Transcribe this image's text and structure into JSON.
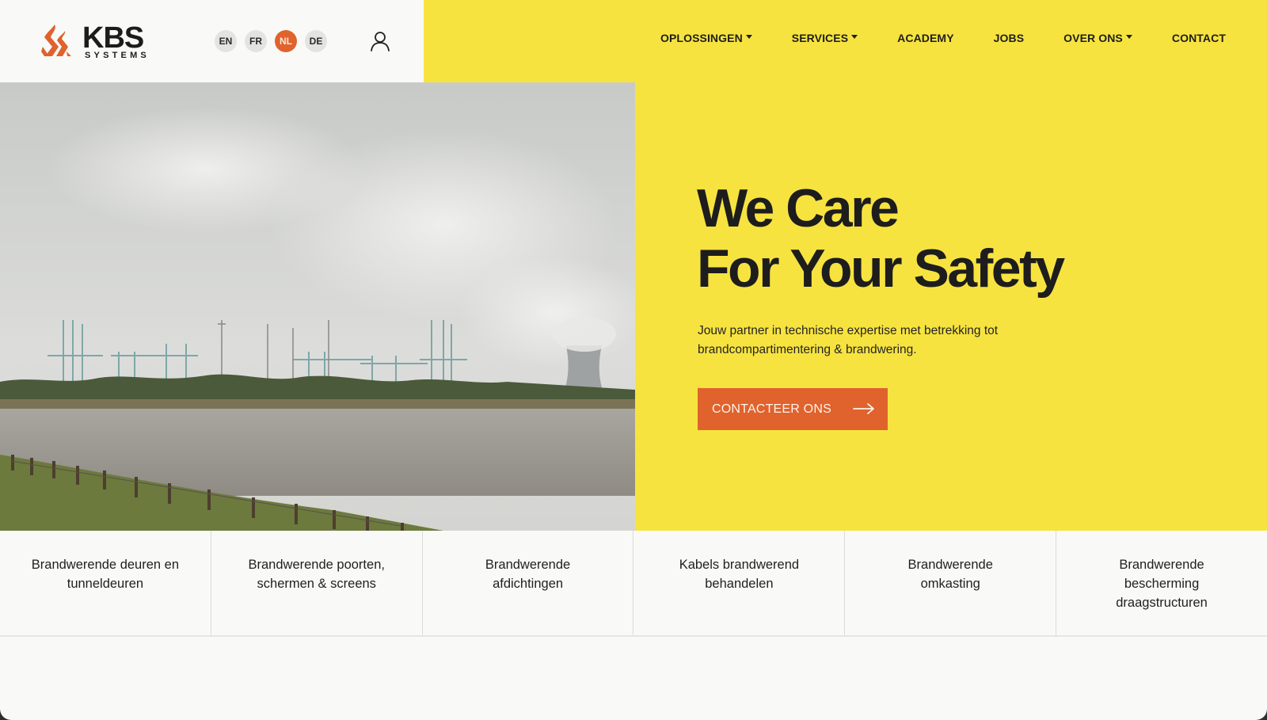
{
  "brand": {
    "name": "KBS",
    "subtitle": "SYSTEMS",
    "accent_color": "#e0622d",
    "yellow": "#f7e33f"
  },
  "languages": [
    {
      "code": "EN",
      "active": false
    },
    {
      "code": "FR",
      "active": false
    },
    {
      "code": "NL",
      "active": true
    },
    {
      "code": "DE",
      "active": false
    }
  ],
  "nav": {
    "items": [
      {
        "label": "OPLOSSINGEN",
        "dropdown": true
      },
      {
        "label": "SERVICES",
        "dropdown": true
      },
      {
        "label": "ACADEMY",
        "dropdown": false
      },
      {
        "label": "JOBS",
        "dropdown": false
      },
      {
        "label": "OVER ONS",
        "dropdown": true
      },
      {
        "label": "CONTACT",
        "dropdown": false
      }
    ]
  },
  "hero": {
    "headline_line1": "We Care",
    "headline_line2_prefix": "For Your ",
    "headline_highlight": "Safety",
    "tagline": "Jouw partner in technische expertise met betrekking tot brandcompartimentering & brandwering.",
    "cta_label": "CONTACTEER ONS"
  },
  "solutions": [
    {
      "label": "Brandwerende deuren en tunneldeuren"
    },
    {
      "label": "Brandwerende poorten, schermen & screens"
    },
    {
      "label": "Brandwerende afdichtingen"
    },
    {
      "label": "Kabels brandwerend behandelen"
    },
    {
      "label": "Brandwerende omkasting"
    },
    {
      "label": "Brandwerende bescherming draagstructuren"
    }
  ]
}
